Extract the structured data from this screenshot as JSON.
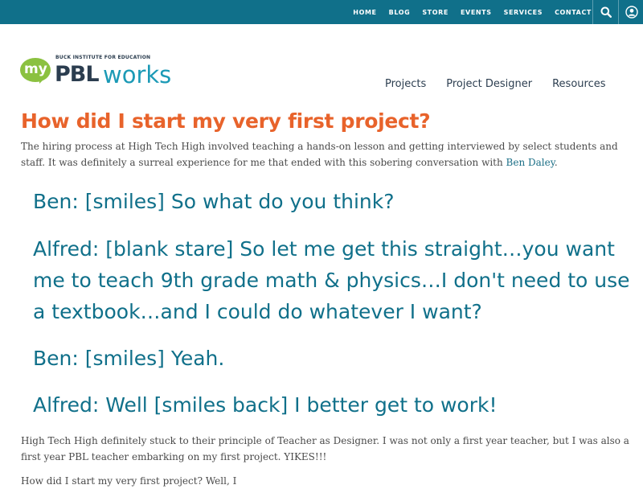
{
  "topnav": {
    "items": [
      "HOME",
      "BLOG",
      "STORE",
      "EVENTS",
      "SERVICES",
      "CONTACT"
    ]
  },
  "logo": {
    "my": "my",
    "subtitle": "BUCK INSTITUTE FOR EDUCATION",
    "pbl": "PBL",
    "works": "works"
  },
  "mainnav": {
    "items": [
      "Projects",
      "Project Designer",
      "Resources"
    ]
  },
  "article": {
    "title": "How did I start my very first project?",
    "intro": "The hiring process at High Tech High involved teaching a hands-on lesson and getting interviewed by select students and staff.  It was definitely a surreal experience for me that ended with this sobering conversation with ",
    "intro_link": "Ben Daley",
    "intro_end": ".",
    "quotes": [
      "Ben:  [smiles] So what do you think?",
      "Alfred:  [blank stare] So let me get this straight…you want me to teach 9th grade math & physics…I don't need to use a textbook…and I could do whatever I want?",
      "Ben:  [smiles] Yeah.",
      "Alfred: Well [smiles back] I better get to work!"
    ],
    "para2": "High Tech High definitely stuck to their principle of Teacher as Designer.  I was not only a first year teacher, but I was also a first year PBL teacher embarking on my first project. YIKES!!!",
    "para3": "How did I start my very first project?  Well, I"
  },
  "colors": {
    "topbar": "#10708a",
    "title": "#e8632b",
    "quote": "#10708a",
    "logo_green": "#8bc140",
    "logo_teal": "#1c9ab6"
  }
}
